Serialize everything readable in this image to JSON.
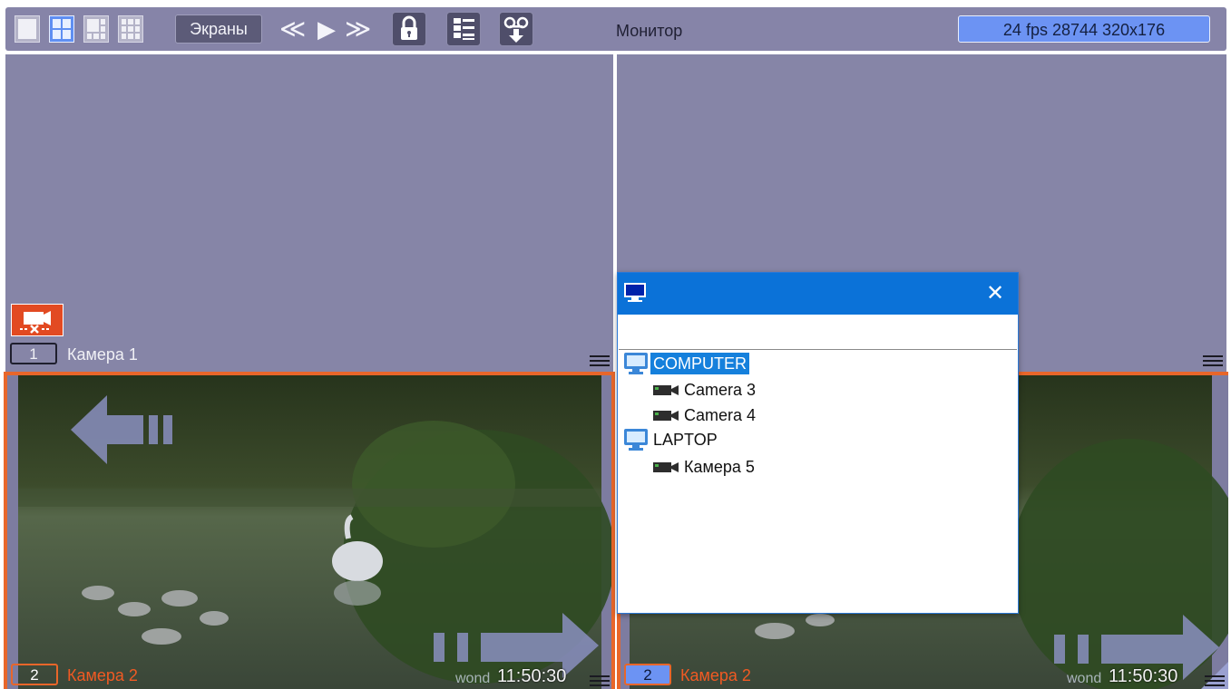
{
  "toolbar": {
    "screens_label": "Экраны",
    "nav_prev": "≪",
    "nav_play": "▶",
    "nav_next": "≫",
    "monitor_label": "Монитор",
    "fps_status": "24 fps  28744 320x176"
  },
  "tiles": [
    {
      "number": "1",
      "name": "Камера 1",
      "status": "disconnected"
    },
    {
      "number": "",
      "name": ""
    },
    {
      "number": "2",
      "name": "Камера 2",
      "watermark": "wond",
      "time": "11:50:30"
    },
    {
      "number": "2",
      "name": "Камера 2",
      "watermark": "wond",
      "time": "11:50:30"
    }
  ],
  "popup": {
    "close_glyph": "✕",
    "search_value": "",
    "tree": [
      {
        "type": "computer",
        "label": "COMPUTER",
        "selected": true
      },
      {
        "type": "camera",
        "label": "Camera 3"
      },
      {
        "type": "camera",
        "label": "Camera 4"
      },
      {
        "type": "computer",
        "label": "LAPTOP"
      },
      {
        "type": "camera",
        "label": "Камера 5"
      }
    ]
  },
  "colors": {
    "accent_orange": "#e8662a",
    "toolbar_bg": "#8684a8",
    "tile_empty_bg": "#8685a7",
    "selection_blue": "#1580dc",
    "popup_title_blue": "#0b72d8",
    "fps_box": "#6c93f3"
  }
}
